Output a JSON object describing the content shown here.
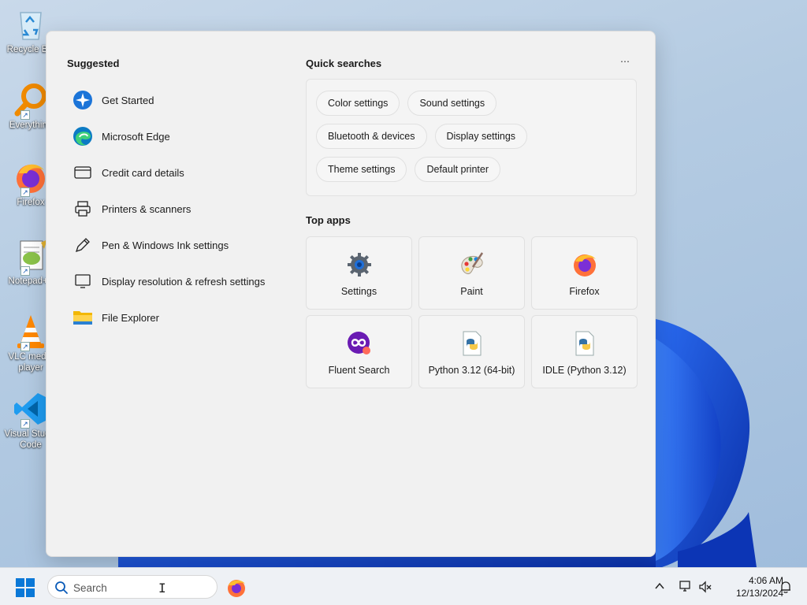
{
  "desktop": {
    "icons": [
      {
        "label": "Recycle Bin",
        "icon": "recycle-bin-icon"
      },
      {
        "label": "Everything",
        "icon": "everything-search-icon"
      },
      {
        "label": "Firefox",
        "icon": "firefox-icon"
      },
      {
        "label": "Notepad++",
        "icon": "notepad-plus-plus-icon"
      },
      {
        "label": "VLC media player",
        "icon": "vlc-icon"
      },
      {
        "label": "Visual Studio Code",
        "icon": "vscode-icon"
      }
    ]
  },
  "search_panel": {
    "suggestions_title": "Suggested",
    "suggestions": [
      {
        "label": "Get Started",
        "icon": "get-started-icon"
      },
      {
        "label": "Microsoft Edge",
        "icon": "edge-icon"
      },
      {
        "label": "Credit card details",
        "icon": "card-icon"
      },
      {
        "label": "Printers & scanners",
        "icon": "printer-icon"
      },
      {
        "label": "Pen & Windows Ink settings",
        "icon": "pen-icon"
      },
      {
        "label": "Display resolution & refresh settings",
        "icon": "display-icon"
      },
      {
        "label": "File Explorer",
        "icon": "folder-icon"
      }
    ],
    "quick_searches_title": "Quick searches",
    "quick_searches": [
      [
        "Color settings",
        "Sound settings"
      ],
      [
        "Bluetooth & devices",
        "Display settings"
      ],
      [
        "Theme settings",
        "Default printer"
      ]
    ],
    "top_apps_title": "Top apps",
    "top_apps": [
      {
        "label": "Settings",
        "icon": "settings-gear-icon"
      },
      {
        "label": "Paint",
        "icon": "paint-palette-icon"
      },
      {
        "label": "Firefox",
        "icon": "firefox-icon"
      },
      {
        "label": "Fluent Search",
        "icon": "fluent-search-icon"
      },
      {
        "label": "Python 3.12 (64-bit)",
        "icon": "python-file-icon"
      },
      {
        "label": "IDLE (Python 3.12)",
        "icon": "python-file-icon"
      }
    ]
  },
  "taskbar": {
    "search_placeholder": "Search",
    "time": "4:06 AM",
    "date": "12/13/2024"
  },
  "colors": {
    "accent": "#0067c0",
    "panel_bg": "#f1f1f1",
    "taskbar_bg": "#eef1f5"
  }
}
